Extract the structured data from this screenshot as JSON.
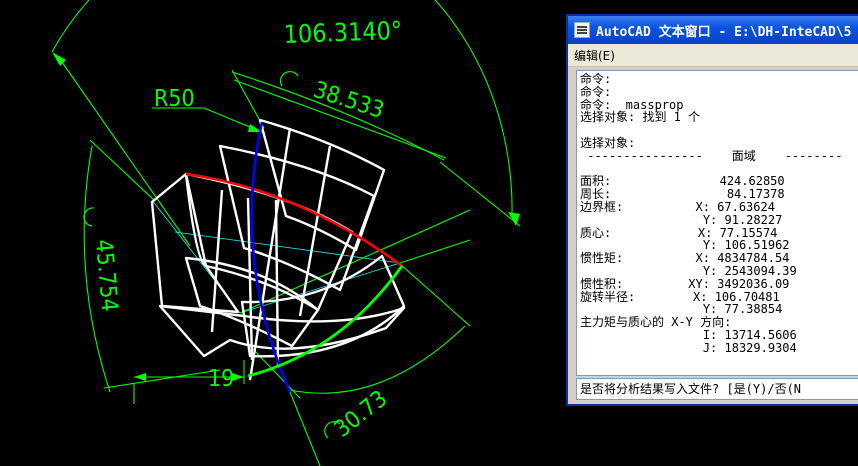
{
  "drawing": {
    "dimensions": {
      "angle": "106.3140°",
      "radius": "R50",
      "arc_top": "38.533",
      "arc_left": "45.754",
      "arc_bottom": "30.73",
      "linear_bottom": "19"
    }
  },
  "text_window": {
    "title": "AutoCAD 文本窗口 - E:\\DH-InteCAD\\5",
    "menu_edit": "编辑(E)",
    "lines": [
      "命令:",
      "命令:",
      "命令: _massprop",
      "选择对象: 找到 1 个",
      "",
      "选择对象:",
      " ----------------    面域    --------",
      "",
      "面积:               424.62850",
      "周长:                84.17378",
      "边界框:          X: 67.63624",
      "                 Y: 91.28227",
      "质心:            X: 77.15574",
      "                 Y: 106.51962",
      "惯性矩:          X: 4834784.54",
      "                 Y: 2543094.39",
      "惯性积:         XY: 3492036.09",
      "旋转半径:        X: 106.70481",
      "                 Y: 77.38854",
      "主力矩与质心的 X-Y 方向:",
      "                 I: 13714.5606",
      "                 J: 18329.9304"
    ],
    "prompt": "是否将分析结果写入文件? [是(Y)/否(N"
  },
  "colors": {
    "background": "#000000",
    "dimension": "#00ff00",
    "geometry": "#ffffff",
    "curve_red": "#ff0000",
    "curve_blue": "#0000ff",
    "curve_green": "#00ff00",
    "guide_cyan": "#00ffff"
  }
}
